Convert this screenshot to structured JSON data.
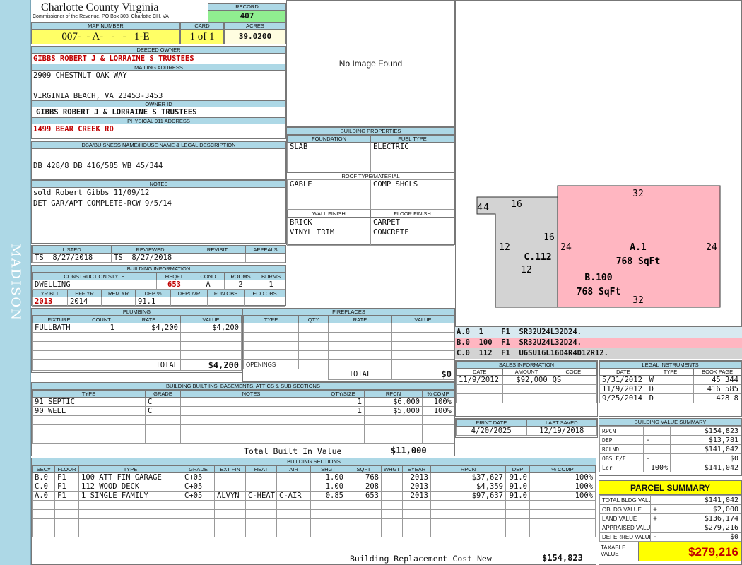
{
  "sidebar": {
    "text": "MADISON"
  },
  "header": {
    "county": "Charlotte County Virginia",
    "office": "Commissioner of the Revenue, PO Box 308, Charlotte CH, VA",
    "record_label": "RECORD",
    "record": "407",
    "map_number_label": "MAP NUMBER",
    "map_number": "007-  - A-   -   -   1-E",
    "card_label": "CARD",
    "card": "1 of 1",
    "acres_label": "ACRES",
    "acres": "39.0200"
  },
  "owner": {
    "deeded_owner_label": "DEEDED OWNER",
    "deeded_owner": "GIBBS ROBERT J & LORRAINE S TRUSTEES",
    "mailing_address_label": "MAILING ADDRESS",
    "address_line1": "2909 CHESTNUT OAK WAY",
    "address_line2": "VIRGINIA BEACH, VA 23453-3453",
    "owner_id_label": "OWNER ID",
    "owner_id": "GIBBS ROBERT J & LORRAINE S TRUSTEES",
    "physical_address_label": "PHYSICAL 911 ADDRESS",
    "physical_address": "1499 BEAR CREEK RD"
  },
  "legal": {
    "label": "DBA/BUISNESS NAME/HOUSE NAME & LEGAL DESCRIPTION",
    "text": "DB 428/8 DB 416/585 WB 45/344"
  },
  "notes": {
    "label": "NOTES",
    "lines": [
      "sold Robert Gibbs 11/09/12",
      "DET GAR/APT COMPLETE-RCW 9/5/14"
    ]
  },
  "listing": {
    "listed_label": "LISTED",
    "reviewed_label": "REVIEWED",
    "revisit_label": "REVISIT",
    "appeals_label": "APPEALS",
    "listed_by": "TS",
    "listed_date": "8/27/2018",
    "reviewed_by": "TS",
    "reviewed_date": "8/27/2018"
  },
  "building_info": {
    "label": "BUILDING INFORMATION",
    "construction_style_label": "CONSTRUCTION STYLE",
    "hsqft_label": "HSQFT",
    "cond_label": "COND",
    "rooms_label": "ROOMS",
    "bdrms_label": "BDRMS",
    "construction_style": "DWELLING",
    "hsqft": "653",
    "cond": "A",
    "rooms": "2",
    "bdrms": "1",
    "yr_blt_label": "YR BLT",
    "eff_yr_label": "EFF YR",
    "rem_yr_label": "REM YR",
    "dep_label": "DEP %",
    "depovr_label": "DEPOVR",
    "fun_obs_label": "FUN OBS",
    "eco_obs_label": "ECO OBS",
    "yr_blt": "2013",
    "eff_yr": "2014",
    "dep": "91.1"
  },
  "image_panel": {
    "text": "No Image Found"
  },
  "building_props": {
    "label": "BUILDING PROPERTIES",
    "foundation_label": "FOUNDATION",
    "fuel_type_label": "FUEL TYPE",
    "foundation": "SLAB",
    "fuel_type": "ELECTRIC",
    "roof_label": "ROOF TYPE/MATERIAL",
    "roof_type": "GABLE",
    "roof_material": "COMP SHGLS",
    "wall_finish_label": "WALL FINISH",
    "floor_finish_label": "FLOOR FINISH",
    "wall_finish": [
      "BRICK",
      "VINYL TRIM"
    ],
    "floor_finish": [
      "CARPET",
      "CONCRETE"
    ]
  },
  "sketch": {
    "a_label": "A.1",
    "a_sqft": "768 SqFt",
    "b_label": "B.100",
    "b_sqft": "768 SqFt",
    "c_label": "C.112",
    "dims": {
      "top": "32",
      "bottom": "32",
      "right": "24",
      "left_a": "24",
      "c_top": "16",
      "c_left_small": "4",
      "c_left_small2": "4",
      "c_left": "12",
      "c_bottom": "12",
      "c_right": "16"
    }
  },
  "sections_codes": [
    {
      "text": "A.0  1    F1  SR32U24L32D24.",
      "color": "#ffffff"
    },
    {
      "text": "B.0  100  F1  SR32U24L32D24.",
      "color": "#ffb6c1"
    },
    {
      "text": "C.0  112  F1  U6SU16L16D4R4D12R12.",
      "color": "#d3d3d3"
    }
  ],
  "plumbing": {
    "label": "PLUMBING",
    "headers": [
      "FIXTURE",
      "COUNT",
      "RATE",
      "VALUE"
    ],
    "rows": [
      [
        "FULLBATH",
        "1",
        "$4,200",
        "$4,200"
      ]
    ],
    "total_label": "TOTAL",
    "total": "$4,200"
  },
  "fireplaces": {
    "label": "FIREPLACES",
    "headers": [
      "TYPE",
      "QTY",
      "RATE",
      "VALUE"
    ],
    "openings_label": "OPENINGS",
    "total_label": "TOTAL",
    "total": "$0"
  },
  "builtins": {
    "label": "BUILDING BUILT INS, BASEMENTS, ATTICS & SUB SECTIONS",
    "headers": [
      "TYPE",
      "GRADE",
      "NOTES",
      "QTY/SIZE",
      "RPCN",
      "% COMP"
    ],
    "rows": [
      [
        "91 SEPTIC",
        "C",
        "",
        "1",
        "$6,000",
        "100%"
      ],
      [
        "90 WELL",
        "C",
        "",
        "1",
        "$5,000",
        "100%"
      ]
    ],
    "total_label": "Total Built In Value",
    "total": "$11,000"
  },
  "sales": {
    "label": "SALES INFORMATION",
    "headers": [
      "DATE",
      "AMOUNT",
      "CODE"
    ],
    "rows": [
      [
        "11/9/2012",
        "$92,000",
        "QS"
      ]
    ]
  },
  "legal_instruments": {
    "label": "LEGAL INSTRUMENTS",
    "headers": [
      "DATE",
      "TYPE",
      "BOOK PAGE"
    ],
    "rows": [
      [
        "5/31/2012",
        "W",
        "45 344"
      ],
      [
        "11/9/2012",
        "D",
        "416 585"
      ],
      [
        "9/25/2014",
        "D",
        "428 8"
      ]
    ]
  },
  "dates": {
    "print_label": "PRINT DATE",
    "saved_label": "LAST SAVED",
    "print_date": "4/20/2025",
    "last_saved": "12/19/2018"
  },
  "bldg_value_summary": {
    "label": "BUILDING VALUE SUMMARY",
    "rows": [
      {
        "label": "RPCN",
        "sign": "",
        "value": "$154,823"
      },
      {
        "label": "DEP",
        "sign": "-",
        "value": "$13,781"
      },
      {
        "label": "RCLND",
        "sign": "",
        "value": "$141,042"
      },
      {
        "label": "OBS F/E",
        "sign": "-",
        "value": "$0"
      },
      {
        "label": "Lcr",
        "sign": "100%",
        "value": "$141,042"
      }
    ]
  },
  "sections": {
    "label": "BUILDING SECTIONS",
    "headers": [
      "SEC#",
      "FLOOR",
      "TYPE",
      "GRADE",
      "EXT FIN",
      "HEAT",
      "AIR",
      "SHGT",
      "SQFT",
      "WHGT",
      "EYEAR",
      "RPCN",
      "DEP",
      "% COMP"
    ],
    "rows": [
      [
        "B.0",
        "F1",
        "100 ATT FIN GARAGE",
        "C+05",
        "",
        "",
        "",
        "1.00",
        "768",
        "",
        "2013",
        "$37,627",
        "91.0",
        "100%"
      ],
      [
        "C.0",
        "F1",
        "112 WOOD DECK",
        "C+05",
        "",
        "",
        "",
        "1.00",
        "208",
        "",
        "2013",
        "$4,359",
        "91.0",
        "100%"
      ],
      [
        "A.0",
        "F1",
        "1 SINGLE FAMILY",
        "C+05",
        "ALVYN",
        "C-HEAT",
        "C-AIR",
        "0.85",
        "653",
        "",
        "2013",
        "$97,637",
        "91.0",
        "100%"
      ]
    ],
    "total_label": "Building Replacement Cost New",
    "total": "$154,823"
  },
  "parcel_summary": {
    "label": "PARCEL SUMMARY",
    "rows": [
      {
        "label": "TOTAL BLDG VALUE",
        "sign": "",
        "value": "$141,042"
      },
      {
        "label": "OBLDG VALUE",
        "sign": "+",
        "value": "$2,000"
      },
      {
        "label": "LAND VALUE",
        "sign": "+",
        "value": "$136,174"
      },
      {
        "label": "APPRAISED VALUE",
        "sign": "",
        "value": "$279,216"
      },
      {
        "label": "DEFERRED VALUE",
        "sign": "-",
        "value": "$0"
      }
    ],
    "taxable_label_1": "TAXABLE",
    "taxable_label_2": "VALUE",
    "taxable_value": "$279,216"
  }
}
